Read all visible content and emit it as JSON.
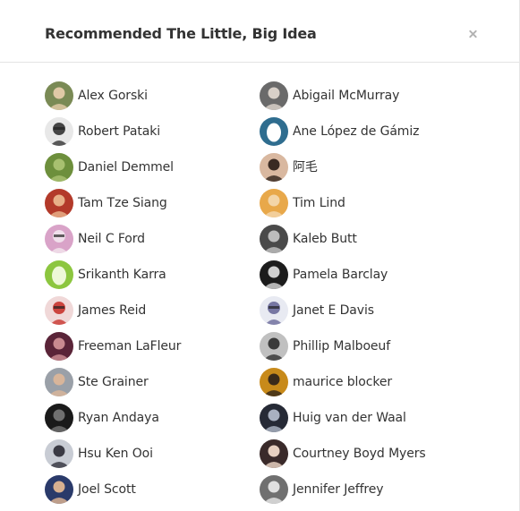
{
  "dialog": {
    "title": "Recommended The Little, Big Idea",
    "close_label": "×"
  },
  "users_left": [
    {
      "name": "Alex Gorski",
      "bg": "#7a8a55",
      "fg": "#e0c9a6",
      "icon": "photo-avatar-icon"
    },
    {
      "name": "Robert Pataki",
      "bg": "#e8e8e8",
      "fg": "#333333",
      "icon": "illustration-avatar-icon"
    },
    {
      "name": "Daniel Demmel",
      "bg": "#6d8f3c",
      "fg": "#a8c070",
      "icon": "photo-avatar-icon"
    },
    {
      "name": "Tam Tze Siang",
      "bg": "#b33a2a",
      "fg": "#e8b088",
      "icon": "photo-avatar-icon"
    },
    {
      "name": "Neil C Ford",
      "bg": "#d9a3c8",
      "fg": "#f2e6ee",
      "icon": "illustration-avatar-icon"
    },
    {
      "name": "Srikanth Karra",
      "bg": "#8cc63f",
      "fg": "#eef8d8",
      "icon": "egg-avatar-icon"
    },
    {
      "name": "James Reid",
      "bg": "#f0d8d8",
      "fg": "#c8342e",
      "icon": "illustration-avatar-icon"
    },
    {
      "name": "Freeman LaFleur",
      "bg": "#5a2438",
      "fg": "#c98a90",
      "icon": "photo-avatar-icon"
    },
    {
      "name": "Ste Grainer",
      "bg": "#9aa0a8",
      "fg": "#d8b59a",
      "icon": "photo-avatar-icon"
    },
    {
      "name": "Ryan Andaya",
      "bg": "#1a1a1a",
      "fg": "#707070",
      "icon": "photo-avatar-icon"
    },
    {
      "name": "Hsu Ken Ooi",
      "bg": "#c8ccd4",
      "fg": "#3a3a44",
      "icon": "photo-avatar-icon"
    },
    {
      "name": "Joel Scott",
      "bg": "#2a3a6a",
      "fg": "#d8b090",
      "icon": "photo-avatar-icon"
    }
  ],
  "users_right": [
    {
      "name": "Abigail McMurray",
      "bg": "#6a6a6a",
      "fg": "#d8d0c8",
      "icon": "photo-avatar-icon"
    },
    {
      "name": "Ane López de Gámiz",
      "bg": "#2f6d8f",
      "fg": "#ffffff",
      "icon": "egg-avatar-icon"
    },
    {
      "name": "阿毛",
      "bg": "#d9b8a0",
      "fg": "#3a2a22",
      "icon": "photo-avatar-icon"
    },
    {
      "name": "Tim Lind",
      "bg": "#e8a84a",
      "fg": "#f3d5a8",
      "icon": "photo-avatar-icon"
    },
    {
      "name": "Kaleb Butt",
      "bg": "#4a4a4a",
      "fg": "#bcbcbc",
      "icon": "photo-avatar-icon"
    },
    {
      "name": "Pamela Barclay",
      "bg": "#1c1c1c",
      "fg": "#cfcfcf",
      "icon": "photo-avatar-icon"
    },
    {
      "name": "Janet E Davis",
      "bg": "#e8eaf2",
      "fg": "#6a6a9a",
      "icon": "illustration-avatar-icon"
    },
    {
      "name": "Phillip Malboeuf",
      "bg": "#c0c0c0",
      "fg": "#3a3a3a",
      "icon": "photo-avatar-icon"
    },
    {
      "name": "maurice blocker",
      "bg": "#c88a1a",
      "fg": "#3a2a1a",
      "icon": "photo-avatar-icon"
    },
    {
      "name": "Huig van der Waal",
      "bg": "#262a36",
      "fg": "#a8b0c0",
      "icon": "photo-avatar-icon"
    },
    {
      "name": "Courtney Boyd Myers",
      "bg": "#3a2a2a",
      "fg": "#e6cfc0",
      "icon": "photo-avatar-icon"
    },
    {
      "name": "Jennifer Jeffrey",
      "bg": "#707070",
      "fg": "#e0e0e0",
      "icon": "photo-avatar-icon"
    }
  ]
}
